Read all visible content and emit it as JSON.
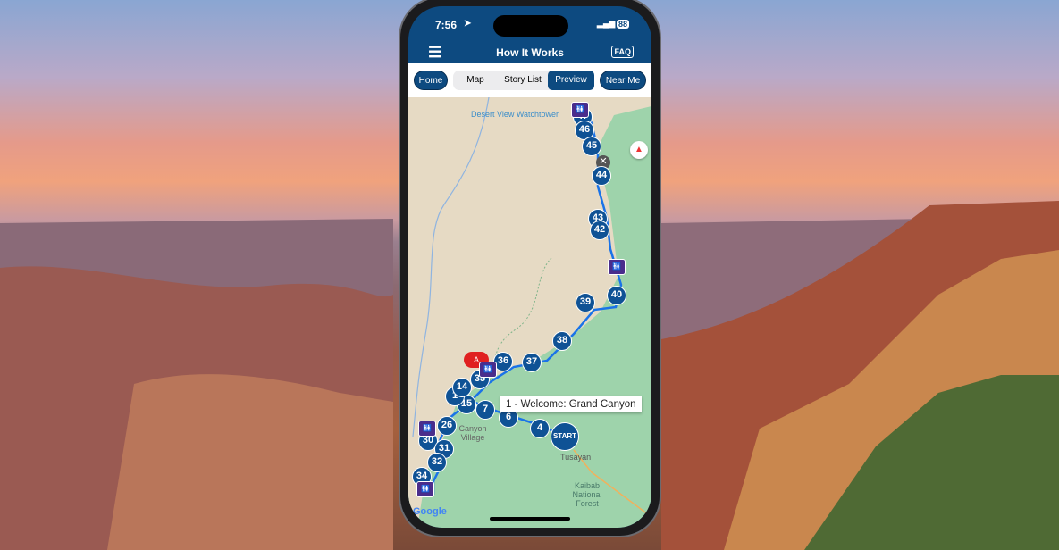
{
  "status": {
    "time": "7:56",
    "battery": "88"
  },
  "header": {
    "title": "How It Works",
    "faq": "FAQ"
  },
  "tabs": {
    "home": "Home",
    "map": "Map",
    "story_list": "Story List",
    "preview": "Preview",
    "near_me": "Near Me",
    "selected": "Preview"
  },
  "map": {
    "labels": [
      "Desert View Watchtower",
      "Tusayan",
      "Kaibab National Forest",
      "Canyon Village"
    ],
    "markers": [
      "47",
      "46",
      "45",
      "44",
      "43",
      "42",
      "40",
      "39",
      "38",
      "37",
      "36",
      "35",
      "15",
      "7",
      "6",
      "4",
      "START",
      "26",
      "30",
      "31",
      "32",
      "34",
      "1",
      "14"
    ],
    "tooltip": "1 - Welcome: Grand Canyon",
    "attribution": "Google",
    "colors": {
      "route": "#1a73e8",
      "marker": "#0f5295",
      "restroom": "#4a2d8c",
      "header": "#0d4a80"
    }
  }
}
